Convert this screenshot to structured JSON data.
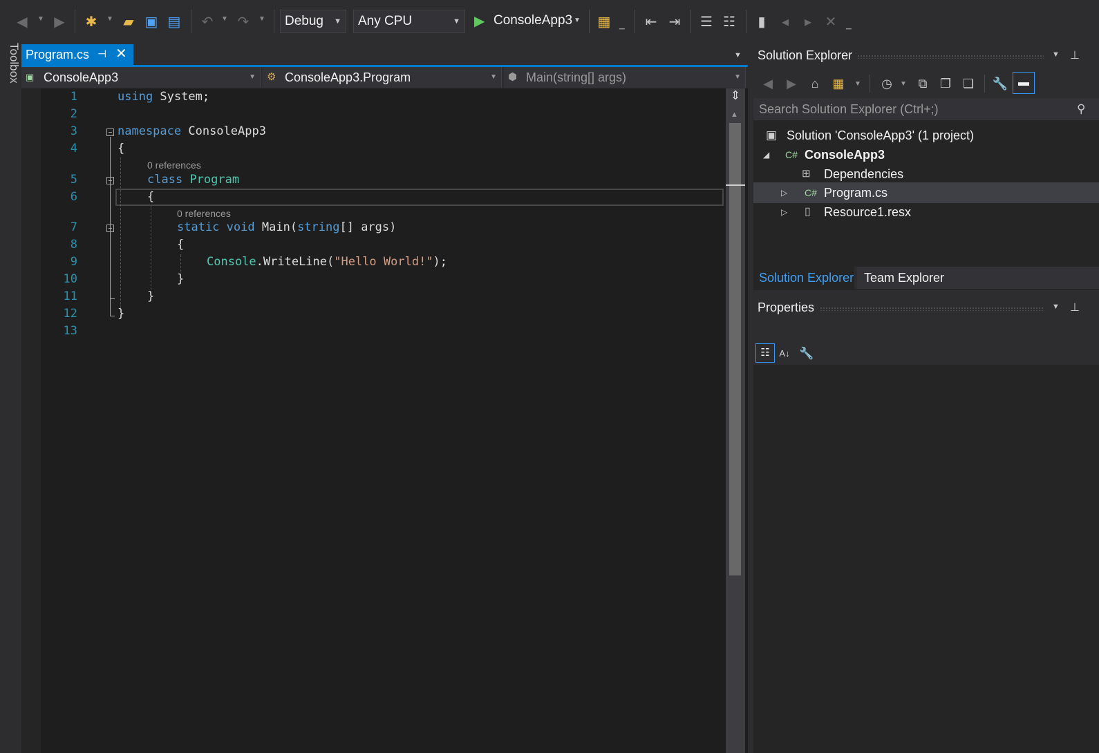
{
  "toolbar": {
    "config": "Debug",
    "platform": "Any CPU",
    "start_target": "ConsoleApp3"
  },
  "toolbox": {
    "label": "Toolbox"
  },
  "tab": {
    "label": "Program.cs"
  },
  "navbar": {
    "project": "ConsoleApp3",
    "type": "ConsoleApp3.Program",
    "member": "Main(string[] args)"
  },
  "editor": {
    "line_numbers": [
      "1",
      "2",
      "3",
      "4",
      "5",
      "6",
      "7",
      "8",
      "9",
      "10",
      "11",
      "12",
      "13"
    ],
    "lens": [
      "0 references",
      "0 references"
    ],
    "code": {
      "l1_kw": "using",
      "l1_rest": " System;",
      "l3_kw": "namespace",
      "l3_rest": " ConsoleApp3",
      "l4": "{",
      "l5_kw": "class",
      "l5_type": "Program",
      "l6": "{",
      "l7_kw": "static",
      "l7_kw2": "void",
      "l7_name": "Main(",
      "l7_kw3": "string",
      "l7_rest": "[] args)",
      "l8": "{",
      "l9_type": "Console",
      "l9_mid": ".WriteLine(",
      "l9_str": "\"Hello World!\"",
      "l9_end": ");",
      "l10": "}",
      "l11": "}",
      "l12": "}"
    }
  },
  "solution_explorer": {
    "title": "Solution Explorer",
    "search_placeholder": "Search Solution Explorer (Ctrl+;)",
    "tree": {
      "solution": "Solution 'ConsoleApp3' (1 project)",
      "project": "ConsoleApp3",
      "dependencies": "Dependencies",
      "program": "Program.cs",
      "resource": "Resource1.resx"
    },
    "tabs": [
      "Solution Explorer",
      "Team Explorer"
    ]
  },
  "properties": {
    "title": "Properties"
  },
  "colors": {
    "accent": "#007acc",
    "keyword": "#569cd6",
    "type": "#4ec9b0",
    "string": "#d69d85",
    "line_number": "#2b91af"
  }
}
